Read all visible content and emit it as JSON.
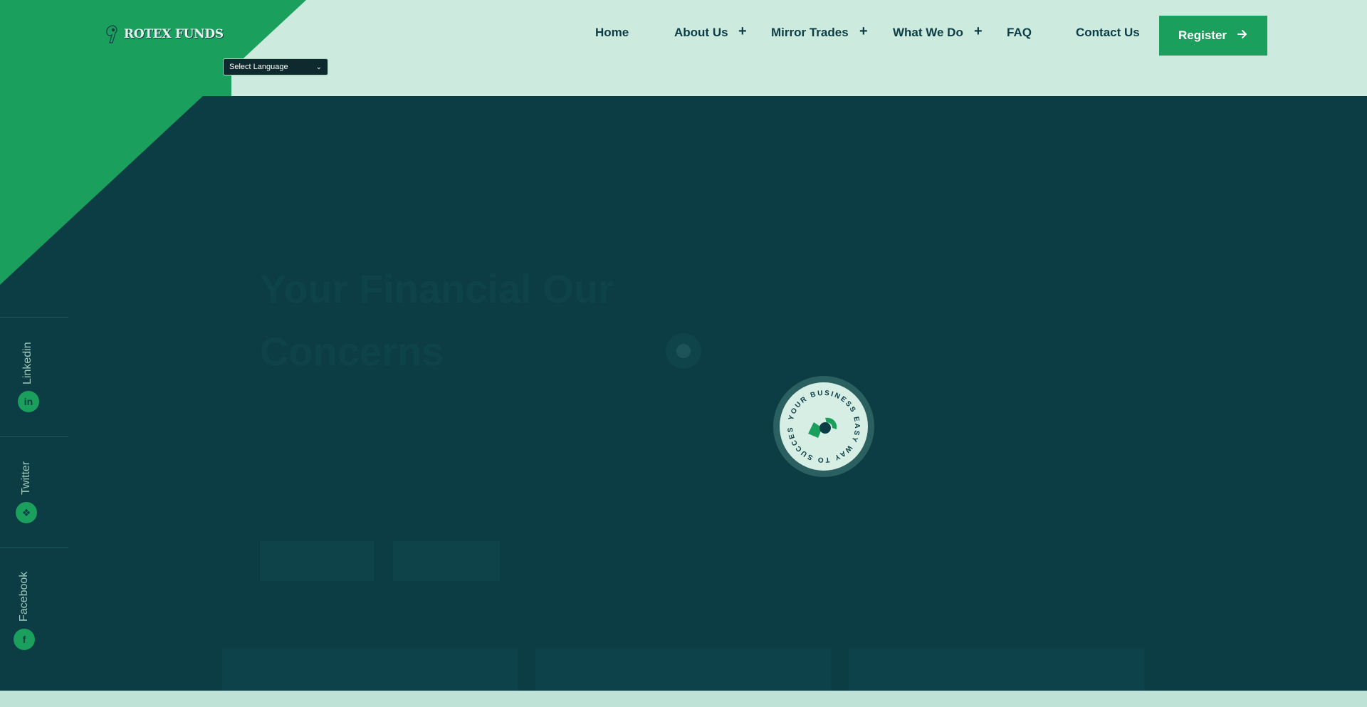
{
  "brand": {
    "name": "ROTEX FUNDS"
  },
  "language": {
    "label": "Select Language"
  },
  "nav": {
    "items": [
      {
        "label": "Home",
        "has_submenu": false
      },
      {
        "label": "About Us",
        "has_submenu": true
      },
      {
        "label": "Mirror Trades",
        "has_submenu": true
      },
      {
        "label": "What We Do",
        "has_submenu": true
      },
      {
        "label": "FAQ",
        "has_submenu": false
      },
      {
        "label": "Contact Us",
        "has_submenu": false
      }
    ],
    "register_label": "Register"
  },
  "hero": {
    "headline": "Your Financial Our Concerns"
  },
  "social": [
    {
      "label": "Linkedin",
      "icon": "linkedin-icon"
    },
    {
      "label": "Twitter",
      "icon": "twitter-icon"
    },
    {
      "label": "Facebook",
      "icon": "facebook-icon"
    }
  ],
  "preloader": {
    "ring_text": "YOUR BUSINESS EASY WAY TO SUCCESS"
  },
  "colors": {
    "accent": "#1aa05c",
    "dark": "#0c3d45",
    "header_bg": "#cdeade"
  }
}
